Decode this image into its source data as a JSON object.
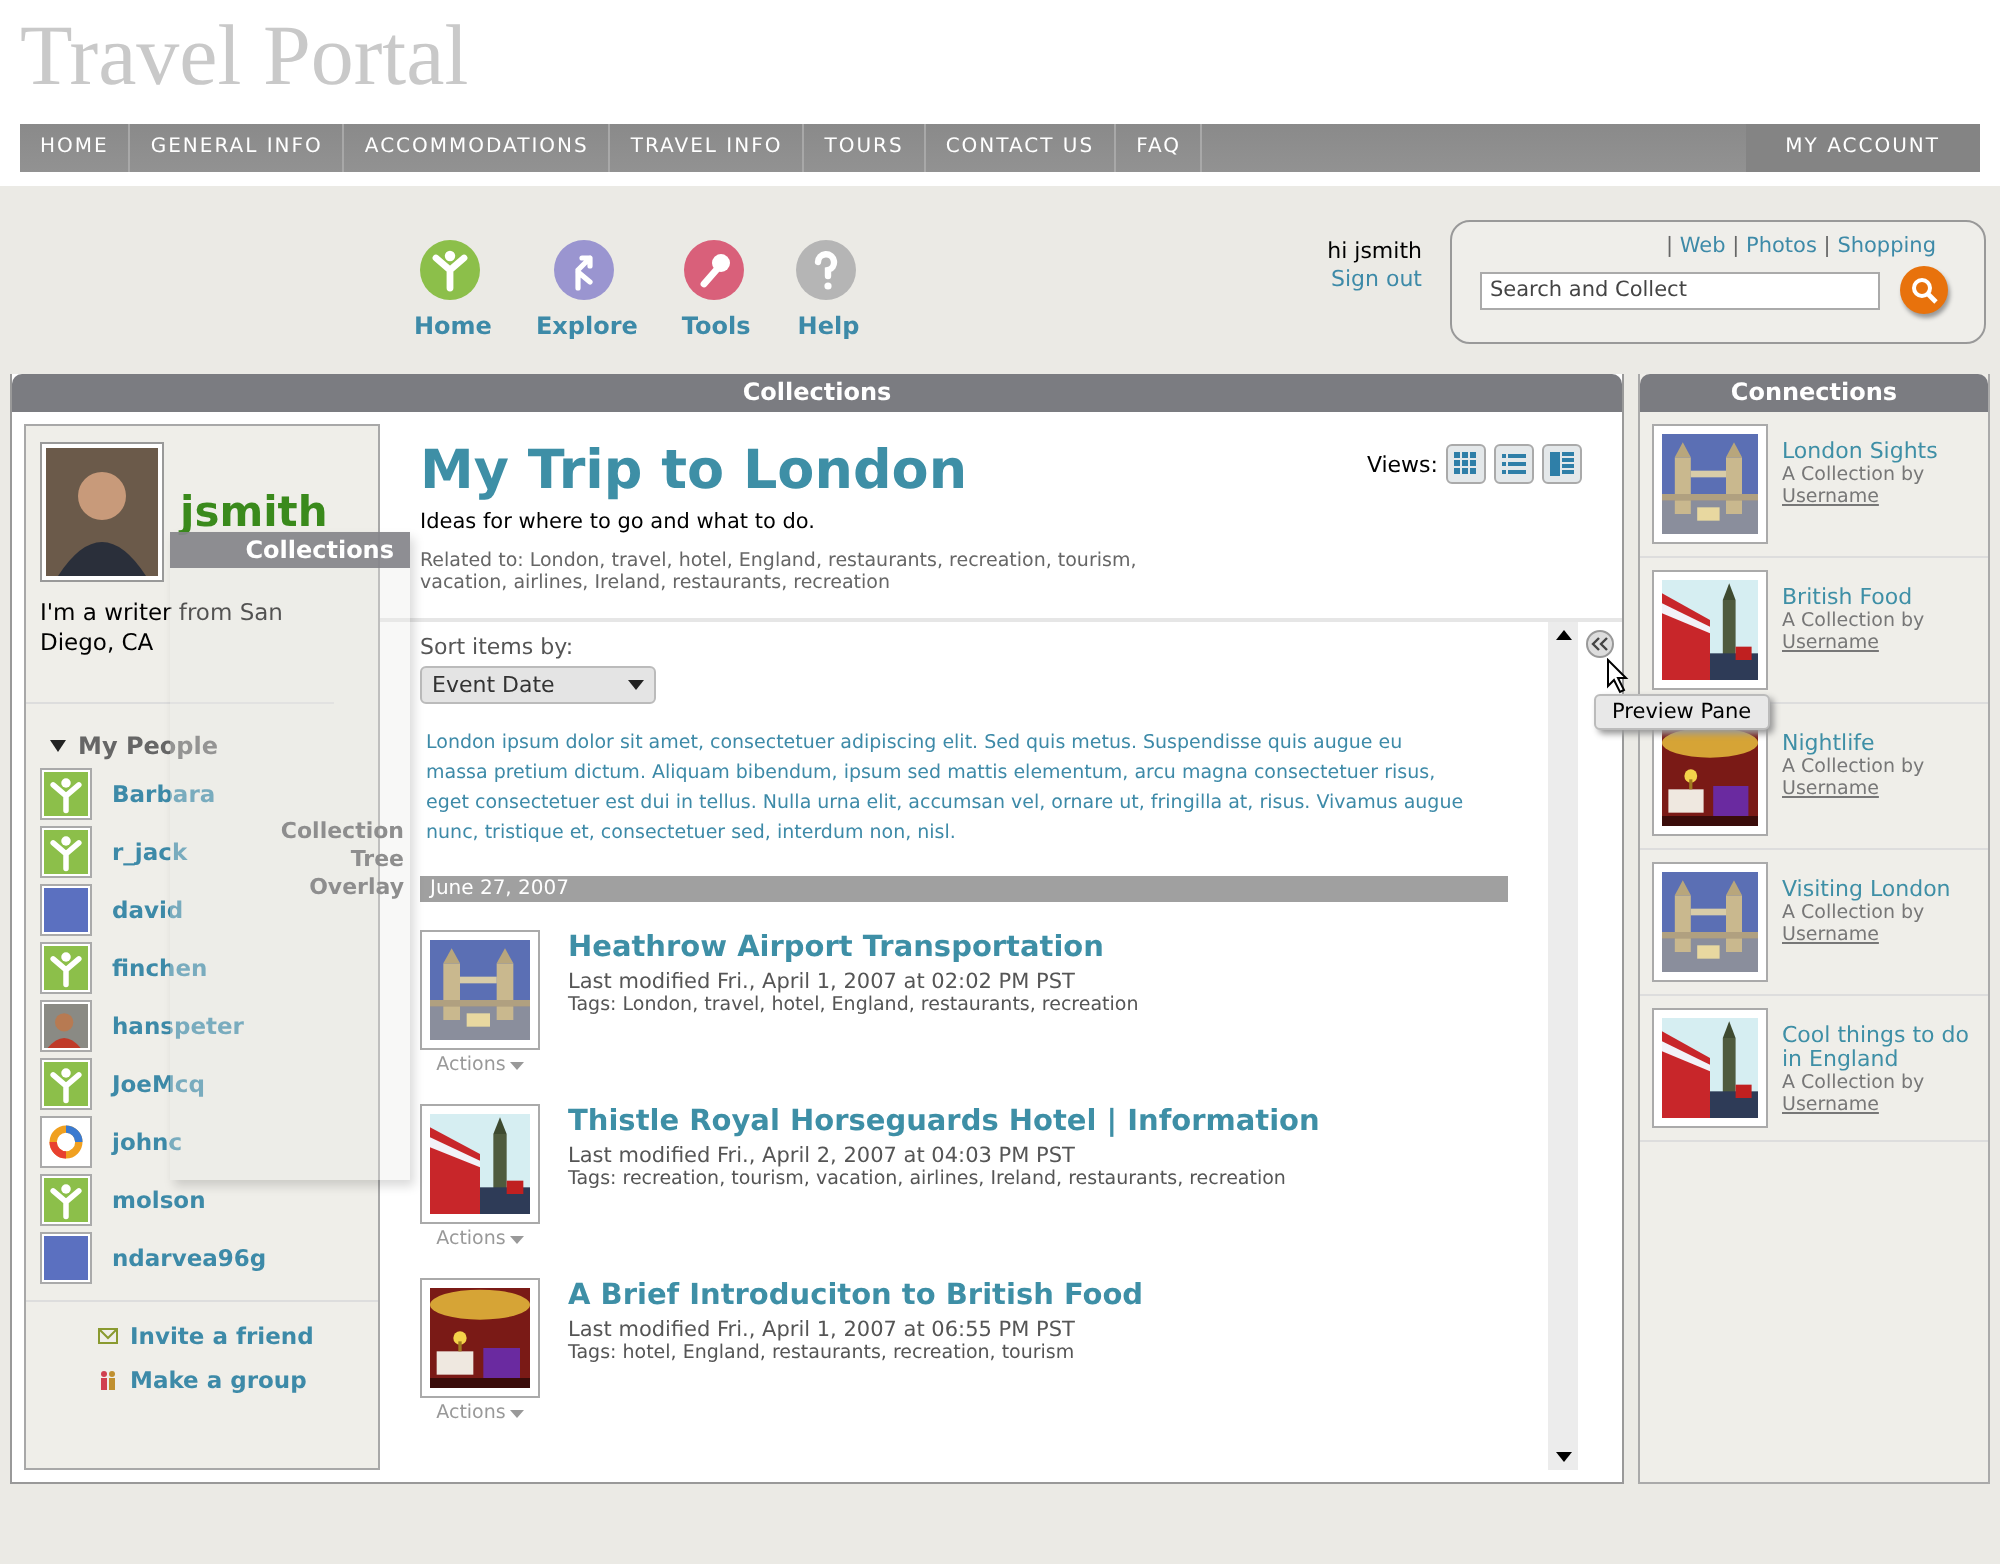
{
  "site_title": "Travel Portal",
  "nav": {
    "items": [
      "HOME",
      "GENERAL INFO",
      "ACCOMMODATIONS",
      "TRAVEL INFO",
      "TOURS",
      "CONTACT US",
      "FAQ"
    ],
    "account": "MY ACCOUNT"
  },
  "toolbar": [
    {
      "label": "Home",
      "kind": "home",
      "color": "#8cbf4a"
    },
    {
      "label": "Explore",
      "kind": "explore",
      "color": "#9a95d0"
    },
    {
      "label": "Tools",
      "kind": "tools",
      "color": "#d9607a"
    },
    {
      "label": "Help",
      "kind": "help",
      "color": "#b5b5b5"
    }
  ],
  "user": {
    "greeting": "hi jsmith",
    "sign_out": "Sign out"
  },
  "search": {
    "separator": "|",
    "links": [
      "Web",
      "Photos",
      "Shopping"
    ],
    "placeholder": "Search and Collect"
  },
  "collections": {
    "header": "Collections",
    "profile": {
      "username": "jsmith",
      "bio": "I'm a writer from San Diego, CA",
      "people_heading": "My People",
      "people": [
        {
          "name": "Barbara",
          "kind": "figure"
        },
        {
          "name": "r_jack",
          "kind": "figure"
        },
        {
          "name": "david",
          "kind": "blank"
        },
        {
          "name": "finchen",
          "kind": "figure"
        },
        {
          "name": "hanspeter"
        },
        {
          "name": "JoeMcq",
          "kind": "figure"
        },
        {
          "name": "johnc",
          "kind": "ring"
        },
        {
          "name": "molson",
          "kind": "figure"
        },
        {
          "name": "ndarvea96g",
          "kind": "blank"
        }
      ],
      "actions": [
        {
          "label": "Invite a friend",
          "kind": "invite"
        },
        {
          "label": "Make a group",
          "kind": "group"
        }
      ]
    },
    "title": "My Trip to London",
    "tagline": "Ideas for where to go and what to do.",
    "related": "Related to: London, travel, hotel, England, restaurants, recreation, tourism, vacation, airlines, Ireland, restaurants, recreation",
    "views_label": "Views:",
    "sort_label": "Sort items by:",
    "sort_value": "Event Date",
    "intro": "London ipsum dolor sit amet, consectetuer adipiscing elit. Sed quis metus. Suspendisse quis augue eu massa pretium dictum. Aliquam bibendum, ipsum sed mattis elementum, arcu magna consectetuer risus, eget consectetuer est dui in tellus. Nulla urna elit, accumsan vel, ornare ut, fringilla at, risus. Vivamus augue nunc, tristique et, consectetuer sed, interdum non, nisl.",
    "date": "June 27, 2007",
    "items": [
      {
        "title": "Heathrow Airport Transportation",
        "modified": "Last modified Fri., April 1, 2007 at 02:02 PM PST",
        "tags": "Tags: London, travel, hotel, England, restaurants, recreation",
        "actions": "Actions"
      },
      {
        "title": "Thistle Royal Horseguards Hotel | Information",
        "modified": "Last modified Fri., April 2, 2007 at 04:03 PM PST",
        "tags": "Tags: recreation, tourism, vacation, airlines, Ireland, restaurants, recreation",
        "actions": "Actions"
      },
      {
        "title": "A Brief Introduciton to British Food",
        "modified": "Last modified Fri., April 1, 2007 at 06:55 PM PST",
        "tags": "Tags: hotel, England, restaurants, recreation, tourism",
        "actions": "Actions"
      }
    ],
    "preview_tooltip": "Preview Pane",
    "overlay": {
      "header": "Collections",
      "label": "Collection Tree Overlay"
    }
  },
  "connections": {
    "header": "Connections",
    "items": [
      {
        "title": "London Sights",
        "by": "A Collection by",
        "user": "Username"
      },
      {
        "title": "British Food",
        "by": "A Collection by",
        "user": "Username"
      },
      {
        "title": "Nightlife",
        "by": "A Collection by",
        "user": "Username"
      },
      {
        "title": "Visiting London",
        "by": "A Collection by",
        "user": "Username"
      },
      {
        "title": "Cool things to do in England",
        "by": "A Collection by",
        "user": "Username"
      }
    ]
  }
}
